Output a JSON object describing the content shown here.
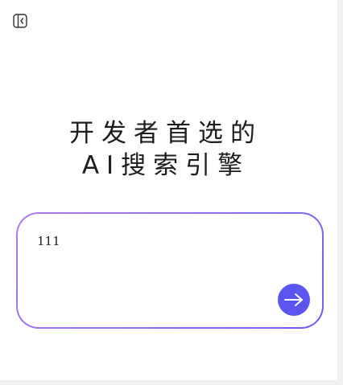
{
  "header": {
    "sidebar_toggle_icon": "sidebar-collapse-icon"
  },
  "hero": {
    "title_line1": "开发者首选的",
    "title_line2": "AI搜索引擎"
  },
  "search": {
    "value": "111",
    "placeholder": "",
    "send_icon": "arrow-right-icon"
  },
  "colors": {
    "accent": "#5b55f0",
    "border_gradient_start": "#b07be6",
    "border_gradient_end": "#6a5cf2",
    "text": "#1c1c1c"
  }
}
